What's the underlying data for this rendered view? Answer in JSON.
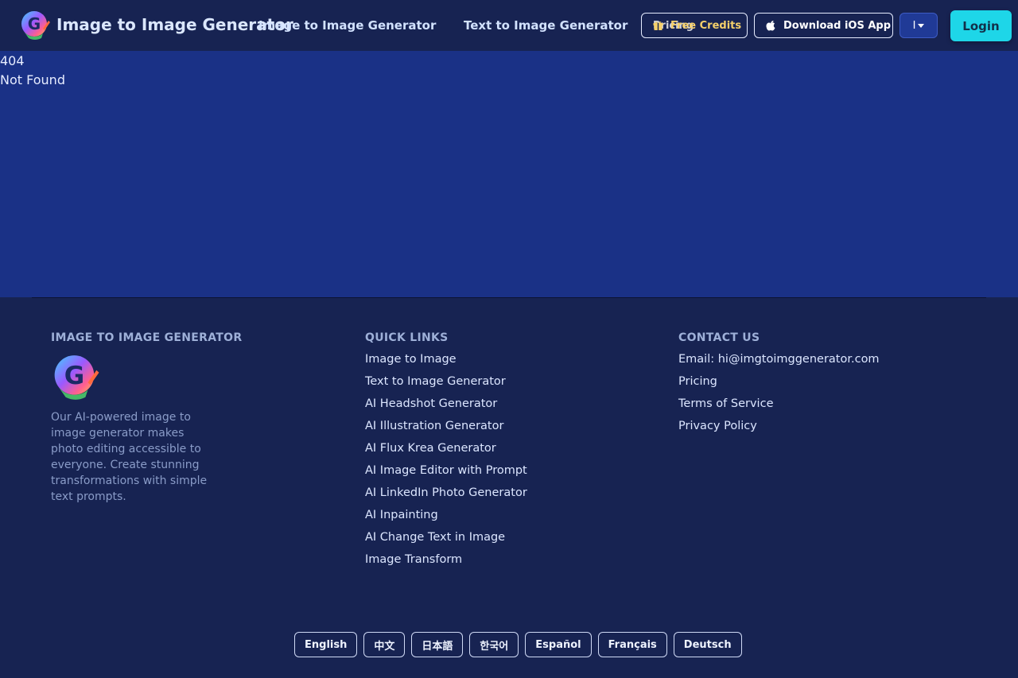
{
  "header": {
    "brand": "Image to Image Generator",
    "logo_icon": "g-logo-icon",
    "nav": [
      {
        "label": "Image to Image Generator"
      },
      {
        "label": "Text to Image Generator"
      }
    ],
    "pricing_label": "Pricing",
    "credits_label": "Free Credits",
    "ios_label": "Download iOS App",
    "lang_label": "I",
    "login_label": "Login"
  },
  "main": {
    "code": "404",
    "message": "Not Found"
  },
  "footer": {
    "col1": {
      "heading": "IMAGE TO IMAGE GENERATOR",
      "description": "Our AI-powered image to image generator makes photo editing accessible to everyone. Create stunning transformations with simple text prompts."
    },
    "col2": {
      "heading": "QUICK LINKS",
      "links": [
        {
          "label": "Image to Image"
        },
        {
          "label": "Text to Image Generator"
        },
        {
          "label": "AI Headshot Generator"
        },
        {
          "label": "AI Illustration Generator"
        },
        {
          "label": "AI Flux Krea Generator"
        },
        {
          "label": "AI Image Editor with Prompt"
        },
        {
          "label": "AI LinkedIn Photo Generator"
        },
        {
          "label": "AI Inpainting"
        },
        {
          "label": "AI Change Text in Image"
        },
        {
          "label": "Image Transform"
        }
      ]
    },
    "col3": {
      "heading": "CONTACT US",
      "links": [
        {
          "label": "Email: hi@imgtoimggenerator.com"
        },
        {
          "label": "Pricing"
        },
        {
          "label": "Terms of Service"
        },
        {
          "label": "Privacy Policy"
        }
      ]
    },
    "languages": [
      {
        "label": "English"
      },
      {
        "label": "中文"
      },
      {
        "label": "日本語"
      },
      {
        "label": "한국어"
      },
      {
        "label": "Español"
      },
      {
        "label": "Français"
      },
      {
        "label": "Deutsch"
      }
    ]
  },
  "colors": {
    "header_bg": "#172352",
    "main_bg": "#1a3186",
    "accent_login": "#1ed6e8",
    "credits_text": "#f5d06a"
  }
}
